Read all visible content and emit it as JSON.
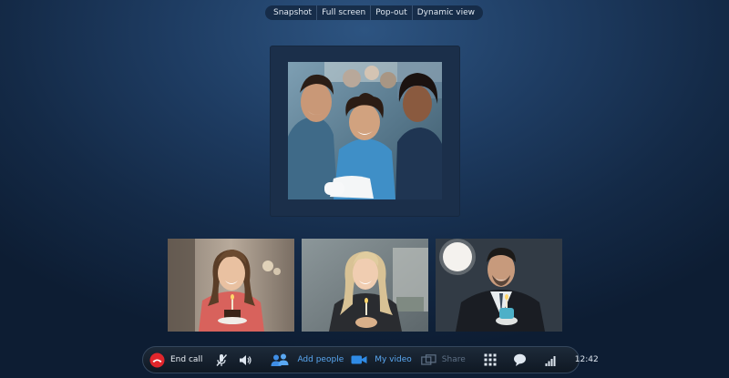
{
  "top_toolbar": {
    "snapshot": "Snapshot",
    "full_screen": "Full screen",
    "pop_out": "Pop-out",
    "dynamic_view": "Dynamic view"
  },
  "call_bar": {
    "end_call": "End call",
    "add_people": "Add people",
    "my_video": "My video",
    "share": "Share",
    "time": "12:42"
  },
  "colors": {
    "end_call_red": "#e1262c",
    "accent_blue": "#2f8be6",
    "link_blue": "#5aa8f2",
    "disabled_text": "#5f7186"
  },
  "icons": {
    "end_call": "phone-hangup-icon",
    "mute": "microphone-muted-icon",
    "speaker": "speaker-icon",
    "add_people": "people-icon",
    "video": "video-camera-icon",
    "share": "share-screen-icon",
    "dialpad": "dialpad-icon",
    "chat": "chat-bubble-icon",
    "signal": "signal-strength-icon"
  }
}
